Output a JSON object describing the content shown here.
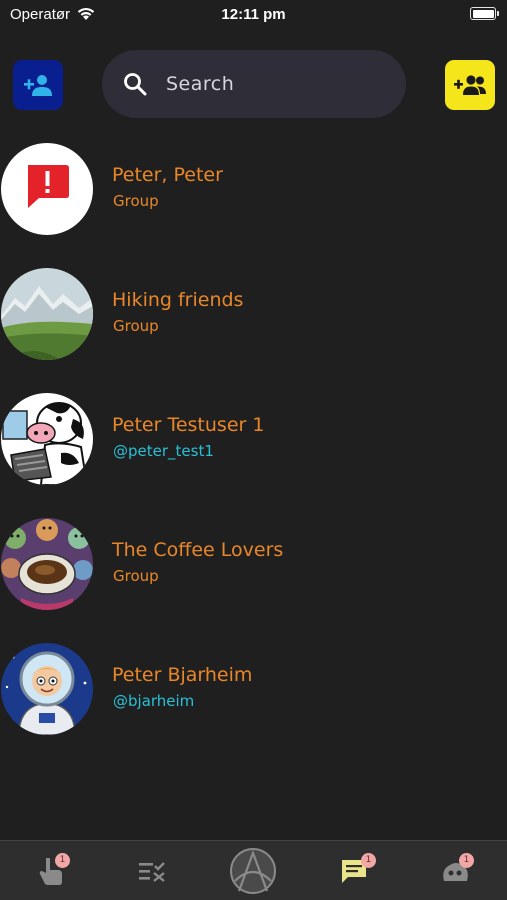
{
  "status_bar": {
    "carrier": "Operatør",
    "time": "12:11 pm"
  },
  "header": {
    "add_contact_icon": "person-add-icon",
    "add_group_icon": "group-add-icon",
    "search": {
      "placeholder": "Search"
    }
  },
  "conversations": [
    {
      "name": "Peter, Peter",
      "subtitle": "Group",
      "kind": "group",
      "avatar": "alert-message-icon"
    },
    {
      "name": "Hiking friends",
      "subtitle": "Group",
      "kind": "group",
      "avatar": "mountain-landscape"
    },
    {
      "name": "Peter Testuser 1",
      "subtitle": "@peter_test1",
      "kind": "user",
      "avatar": "cartoon-cow-laptop"
    },
    {
      "name": "The Coffee Lovers",
      "subtitle": "Group",
      "kind": "group",
      "avatar": "coffee-cup-crowd"
    },
    {
      "name": "Peter Bjarheim",
      "subtitle": "@bjarheim",
      "kind": "user",
      "avatar": "astronaut-cartoon"
    }
  ],
  "tab_bar": {
    "tabs": [
      {
        "name": "pointer-tab",
        "icon": "hand-pointer-icon",
        "badge": "1"
      },
      {
        "name": "checklist-tab",
        "icon": "checklist-icon",
        "badge": ""
      },
      {
        "name": "home-tab",
        "icon": "app-logo-icon",
        "badge": ""
      },
      {
        "name": "chat-tab",
        "icon": "chat-icon",
        "badge": "1",
        "active": true
      },
      {
        "name": "profile-tab",
        "icon": "avatar-blob-icon",
        "badge": "1"
      }
    ]
  },
  "colors": {
    "background": "#1f1f1f",
    "name_text": "#e8872a",
    "handle_text": "#28c0d6",
    "add_contact_bg": "#0a1f8f",
    "add_group_bg": "#f5e61c",
    "search_bg": "#2e2d38",
    "tab_bar_bg": "#2e2e2e",
    "badge_bg": "#f2a7a7"
  }
}
